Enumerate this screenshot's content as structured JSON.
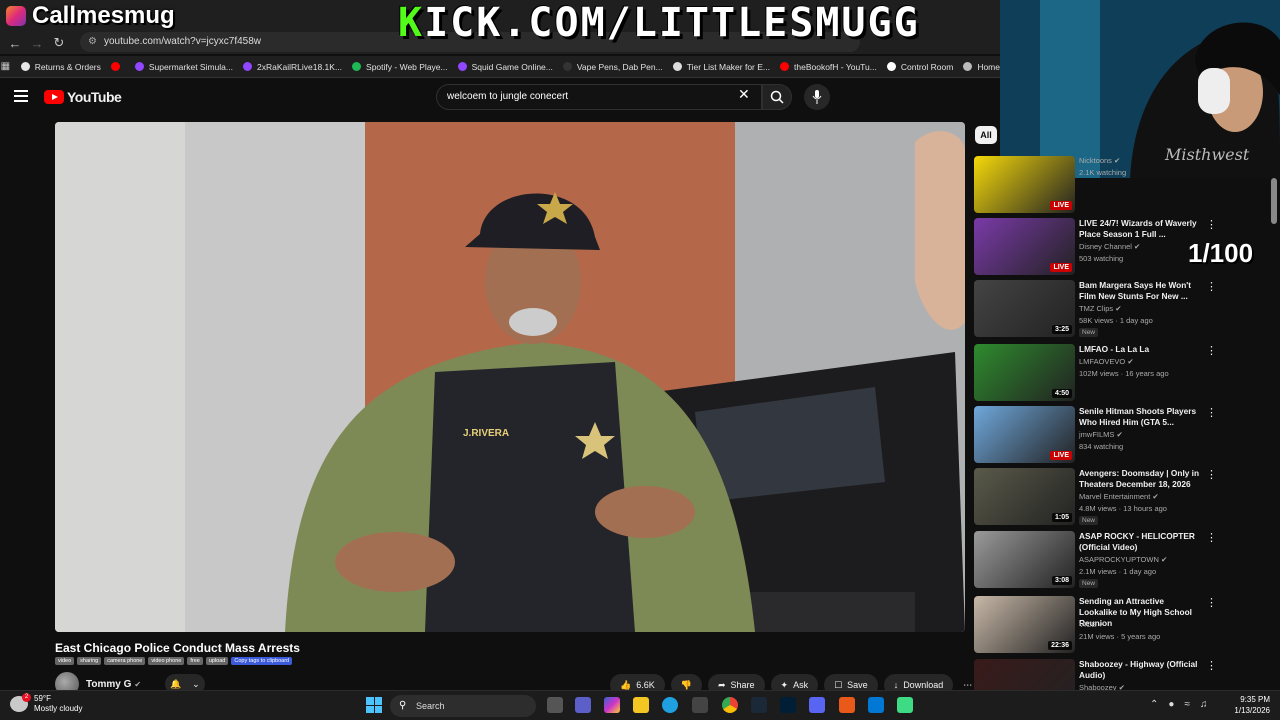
{
  "overlay": {
    "streamer_name": "Callmesmug",
    "kick_prefix": "K",
    "kick_rest": "ICK.COM/LITTLESMUGG",
    "counter": "1/100"
  },
  "browser": {
    "url": "youtube.com/watch?v=jcyxc7f458w",
    "bookmarks": [
      {
        "label": "Returns & Orders",
        "color": "#e6e6e6"
      },
      {
        "label": "",
        "color": "#ff0000"
      },
      {
        "label": "Supermarket Simula...",
        "color": "#9146ff"
      },
      {
        "label": "2xRaKailRLive18.1K...",
        "color": "#9146ff"
      },
      {
        "label": "Spotify - Web Playe...",
        "color": "#1db954"
      },
      {
        "label": "Squid Game Online...",
        "color": "#9146ff"
      },
      {
        "label": "Vape Pens, Dab Pen...",
        "color": "#333333"
      },
      {
        "label": "Tier List Maker for E...",
        "color": "#dddddd"
      },
      {
        "label": "theBookofH - YouTu...",
        "color": "#ff0000"
      },
      {
        "label": "Control Room",
        "color": "#ffffff"
      },
      {
        "label": "Home",
        "color": "#bbbbbb"
      }
    ]
  },
  "youtube": {
    "logo_text": "YouTube",
    "search_query": "welcoem to jungle conecert",
    "video": {
      "title": "East Chicago Police Conduct Mass Arrests",
      "tags": [
        "video",
        "sharing",
        "camera phone",
        "video phone",
        "free",
        "upload"
      ],
      "copy_tags": "Copy tags to clipboard",
      "channel": "Tommy G",
      "likes": "6.6K",
      "share": "Share",
      "ask": "Ask",
      "save": "Save",
      "download": "Download",
      "officer_name": "J.RIVERA"
    },
    "chip_all": "All",
    "recommendations": [
      {
        "title": "",
        "channel": "Nicktoons",
        "meta": "2.1K watching",
        "new": "",
        "badge": "LIVE",
        "live": true,
        "thumb": "#f5d90a"
      },
      {
        "title": "LIVE 24/7! Wizards of Waverly Place Season 1 Full ...",
        "channel": "Disney Channel",
        "meta": "503 watching",
        "new": "",
        "badge": "LIVE",
        "live": true,
        "thumb": "#7a3aa8"
      },
      {
        "title": "Bam Margera Says He Won't Film New Stunts For New ...",
        "channel": "TMZ Clips",
        "meta": "58K views · 1 day ago",
        "new": "New",
        "badge": "3:25",
        "live": false,
        "thumb": "#444444"
      },
      {
        "title": "LMFAO - La La La",
        "channel": "LMFAOVEVO",
        "meta": "102M views · 16 years ago",
        "new": "",
        "badge": "4:50",
        "live": false,
        "thumb": "#2e8b2e"
      },
      {
        "title": "Senile Hitman Shoots Players Who Hired Him (GTA 5...",
        "channel": "jmwFILMS",
        "meta": "834 watching",
        "new": "",
        "badge": "LIVE",
        "live": true,
        "thumb": "#6fa8dc"
      },
      {
        "title": "Avengers: Doomsday | Only in Theaters December 18, 2026",
        "channel": "Marvel Entertainment",
        "meta": "4.8M views · 13 hours ago",
        "new": "New",
        "badge": "1:05",
        "live": false,
        "thumb": "#5a5a4a"
      },
      {
        "title": "ASAP ROCKY - HELICOPTER (Official Video)",
        "channel": "ASAPROCKYUPTOWN",
        "meta": "2.1M views · 1 day ago",
        "new": "New",
        "badge": "3:08",
        "live": false,
        "thumb": "#9a9a9a"
      },
      {
        "title": "Sending an Attractive Lookalike to My High School Reunion",
        "channel": "VICE",
        "meta": "21M views · 5 years ago",
        "new": "",
        "badge": "22:36",
        "live": false,
        "thumb": "#c9b9a8"
      },
      {
        "title": "Shaboozey - Highway (Official Audio)",
        "channel": "Shaboozey",
        "meta": "",
        "new": "",
        "badge": "",
        "live": false,
        "thumb": "#3a1a1a"
      }
    ]
  },
  "taskbar": {
    "temp": "59°F",
    "weather": "Mostly cloudy",
    "weather_badge": "2",
    "search": "Search",
    "time": "9:35 PM",
    "date": "1/13/2026"
  }
}
